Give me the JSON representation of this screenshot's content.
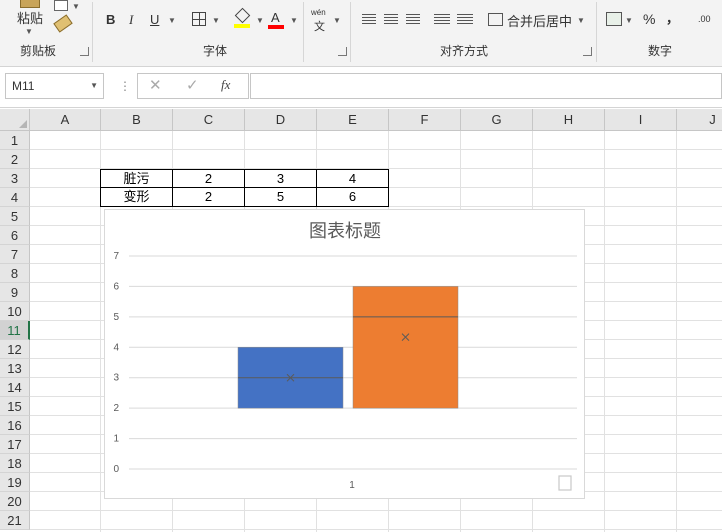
{
  "ribbon": {
    "clipboard": {
      "paste_label": "粘贴",
      "group_label": "剪贴板"
    },
    "font": {
      "bold": "B",
      "italic": "I",
      "underline": "U",
      "font_color": "A",
      "group_label": "字体"
    },
    "alignment": {
      "wen": "wén",
      "wen_char": "文",
      "merge_label": "合并后居中",
      "group_label": "对齐方式"
    },
    "number": {
      "percent": "%",
      "comma": "，",
      "dec": ".00",
      "group_label": "数字"
    }
  },
  "formula_bar": {
    "name_box": "M11",
    "fx_label": "fx",
    "value": ""
  },
  "columns": [
    "A",
    "B",
    "C",
    "D",
    "E",
    "F",
    "G",
    "H",
    "I",
    "J"
  ],
  "rows": [
    "1",
    "2",
    "3",
    "4",
    "5",
    "6",
    "7",
    "8",
    "9",
    "10",
    "11",
    "12",
    "13",
    "14",
    "15",
    "16",
    "17",
    "18",
    "19",
    "20",
    "21"
  ],
  "selected_row": "11",
  "table": [
    [
      "脏污",
      "2",
      "3",
      "4"
    ],
    [
      "变形",
      "2",
      "5",
      "6"
    ]
  ],
  "chart_data": {
    "type": "box",
    "title": "图表标题",
    "categories": [
      "1"
    ],
    "ylim": [
      0,
      7
    ],
    "yticks": [
      "0",
      "1",
      "2",
      "3",
      "4",
      "5",
      "6",
      "7"
    ],
    "grid": true,
    "series": [
      {
        "color": "#4472C4",
        "min": 2,
        "q1": 2,
        "median": 3,
        "q3": 4,
        "max": 4,
        "mean": 3
      },
      {
        "color": "#ED7D31",
        "min": 2,
        "q1": 2,
        "median": 5,
        "q3": 6,
        "max": 6,
        "mean": 4.333
      }
    ]
  },
  "colors": {
    "accent": "#217346"
  }
}
